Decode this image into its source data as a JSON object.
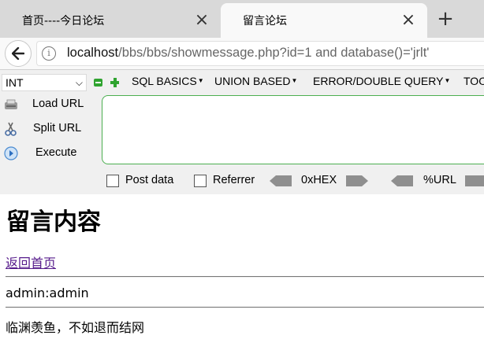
{
  "browser": {
    "tabs": [
      {
        "title": "首页----今日论坛",
        "active": false
      },
      {
        "title": "留言论坛",
        "active": true
      }
    ],
    "new_tab_icon": "plus-icon",
    "url_host": "localhost",
    "url_path": "/bbs/bbs/showmessage.php?id=1 and database()='jrlt'"
  },
  "hackbar": {
    "select_value": "INT",
    "menus": [
      "SQL BASICS",
      "UNION BASED",
      "ERROR/DOUBLE QUERY",
      "TOOLS"
    ],
    "actions": {
      "load": "Load URL",
      "split": "Split URL",
      "execute": "Execute"
    },
    "options": {
      "post_data": "Post data",
      "referrer": "Referrer",
      "hex": "0xHEX",
      "url": "%URL"
    },
    "accent_color": "#2fa32f"
  },
  "page": {
    "heading": "留言内容",
    "home_link": "返回首页",
    "messages": [
      "admin:admin",
      "临渊羡鱼，不如退而结网"
    ]
  }
}
